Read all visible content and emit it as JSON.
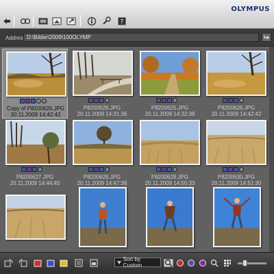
{
  "app": {
    "brand": "OLYMPUS"
  },
  "address": {
    "label": "Address",
    "path": "D:\\Bilder\\2009\\100OLYMP"
  },
  "toolbar": {
    "icons": [
      "back-icon",
      "camera-icon",
      "folder-icon",
      "image-edit-icon",
      "photo-export-icon",
      "info-icon",
      "tools-icon",
      "help-icon"
    ]
  },
  "grid": {
    "items": [
      {
        "name": "Copy of P8200626.JPG",
        "date": "20.11.2009 14:42:42",
        "selected": true
      },
      {
        "name": "P8200626.JPG",
        "date": "20.11.2009 14:31:36",
        "selected": false
      },
      {
        "name": "P8200625.JPG",
        "date": "20.11.2009 14:32:38",
        "selected": false
      },
      {
        "name": "P8200626.JPG",
        "date": "20.11.2009 14:42:42",
        "selected": false
      },
      {
        "name": "P8200627.JPG",
        "date": "20.11.2009 14:44:45",
        "selected": false
      },
      {
        "name": "P8200628.JPG",
        "date": "20.11.2009 14:47:36",
        "selected": false
      },
      {
        "name": "P8200629.JPG",
        "date": "20.11.2009 14:50:33",
        "selected": false
      },
      {
        "name": "P8200630.JPG",
        "date": "20.11.2009 14:51:30",
        "selected": false
      },
      {
        "name": "",
        "date": "",
        "selected": false
      },
      {
        "name": "",
        "date": "",
        "selected": false
      },
      {
        "name": "",
        "date": "",
        "selected": false
      },
      {
        "name": "",
        "date": "",
        "selected": false
      }
    ]
  },
  "bottom": {
    "sort_label": "Sort by Custom",
    "icons": [
      "rotate-left-icon",
      "rotate-right-icon",
      "color-label-red-icon",
      "color-label-blue-icon",
      "color-label-yellow-icon",
      "frame-icon",
      "print-icon",
      "zoom-icon",
      "find-icon",
      "compare-icon",
      "gallery-icon",
      "grid-view-icon",
      "zoom-slider"
    ]
  }
}
